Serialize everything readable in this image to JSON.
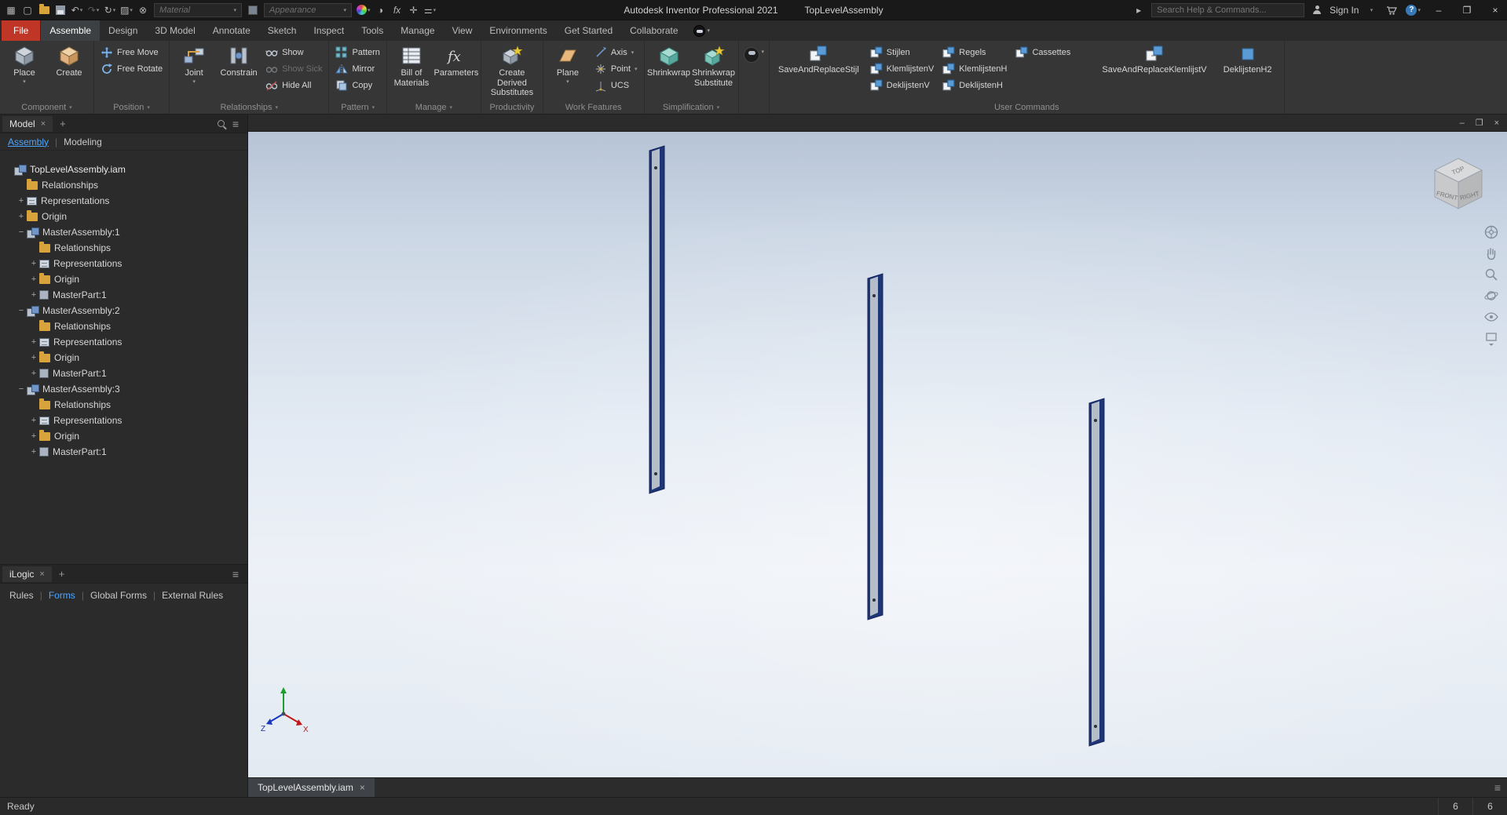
{
  "colors": {
    "file_tab_red": "#bf3526",
    "accent_blue": "#4da6ff",
    "titlebar_bg": "#191919",
    "ribbon_bg": "#363636",
    "panel_bg": "#2b2b2b",
    "viewport_top": "#b7c4d6",
    "viewport_light": "#edf1f7",
    "post_edge": "#1e3576",
    "post_face": "#b4bdc8"
  },
  "titlebar": {
    "app_title": "Autodesk Inventor Professional 2021",
    "doc_title": "TopLevelAssembly",
    "material_label": "Material",
    "appearance_label": "Appearance",
    "search_placeholder": "Search Help & Commands...",
    "signin_label": "Sign In"
  },
  "tabs": {
    "items": [
      "File",
      "Assemble",
      "Design",
      "3D Model",
      "Annotate",
      "Sketch",
      "Inspect",
      "Tools",
      "Manage",
      "View",
      "Environments",
      "Get Started",
      "Collaborate"
    ],
    "active": "Assemble"
  },
  "ribbon": {
    "component": {
      "label": "Component",
      "place": "Place",
      "create": "Create"
    },
    "position": {
      "label": "Position",
      "free_move": "Free Move",
      "free_rotate": "Free Rotate"
    },
    "relationships": {
      "label": "Relationships",
      "joint": "Joint",
      "constrain": "Constrain",
      "show": "Show",
      "show_sick": "Show Sick",
      "hide_all": "Hide All"
    },
    "pattern": {
      "label": "Pattern",
      "pattern": "Pattern",
      "mirror": "Mirror",
      "copy": "Copy"
    },
    "manage": {
      "label": "Manage",
      "bom": "Bill of Materials",
      "parameters": "Parameters"
    },
    "productivity": {
      "label": "Productivity",
      "create_derived": "Create Derived Substitutes"
    },
    "work_features": {
      "label": "Work Features",
      "plane": "Plane",
      "axis": "Axis",
      "point": "Point",
      "ucs": "UCS"
    },
    "simplification": {
      "label": "Simplification",
      "shrinkwrap": "Shrinkwrap",
      "shrinkwrap_substitute": "Shrinkwrap Substitute"
    },
    "user_commands": {
      "label": "User Commands",
      "large": [
        "SaveAndReplaceStijl",
        "SaveAndReplaceKlemlijstV",
        "DeklijstenH2"
      ],
      "col1": [
        "Stijlen",
        "KlemlijstenV",
        "DeklijstenV"
      ],
      "col2": [
        "Regels",
        "KlemlijstenH",
        "DeklijstenH"
      ],
      "col3": [
        "Cassettes"
      ]
    }
  },
  "browser": {
    "tab_label": "Model",
    "subtabs": [
      "Assembly",
      "Modeling"
    ],
    "tree": [
      {
        "expander": "",
        "label": "TopLevelAssembly.iam",
        "indent": 0,
        "icon": "assembly"
      },
      {
        "expander": "",
        "label": "Relationships",
        "indent": 1,
        "icon": "folder"
      },
      {
        "expander": "+",
        "label": "Representations",
        "indent": 1,
        "icon": "representations"
      },
      {
        "expander": "+",
        "label": "Origin",
        "indent": 1,
        "icon": "folder"
      },
      {
        "expander": "−",
        "label": "MasterAssembly:1",
        "indent": 1,
        "icon": "assembly"
      },
      {
        "expander": "",
        "label": "Relationships",
        "indent": 2,
        "icon": "folder"
      },
      {
        "expander": "+",
        "label": "Representations",
        "indent": 2,
        "icon": "representations"
      },
      {
        "expander": "+",
        "label": "Origin",
        "indent": 2,
        "icon": "folder"
      },
      {
        "expander": "+",
        "label": "MasterPart:1",
        "indent": 2,
        "icon": "part"
      },
      {
        "expander": "−",
        "label": "MasterAssembly:2",
        "indent": 1,
        "icon": "assembly"
      },
      {
        "expander": "",
        "label": "Relationships",
        "indent": 2,
        "icon": "folder"
      },
      {
        "expander": "+",
        "label": "Representations",
        "indent": 2,
        "icon": "representations"
      },
      {
        "expander": "+",
        "label": "Origin",
        "indent": 2,
        "icon": "folder"
      },
      {
        "expander": "+",
        "label": "MasterPart:1",
        "indent": 2,
        "icon": "part"
      },
      {
        "expander": "−",
        "label": "MasterAssembly:3",
        "indent": 1,
        "icon": "assembly"
      },
      {
        "expander": "",
        "label": "Relationships",
        "indent": 2,
        "icon": "folder"
      },
      {
        "expander": "+",
        "label": "Representations",
        "indent": 2,
        "icon": "representations"
      },
      {
        "expander": "+",
        "label": "Origin",
        "indent": 2,
        "icon": "folder"
      },
      {
        "expander": "+",
        "label": "MasterPart:1",
        "indent": 2,
        "icon": "part"
      }
    ]
  },
  "ilogic": {
    "tab_label": "iLogic",
    "links": [
      "Rules",
      "Forms",
      "Global Forms",
      "External Rules"
    ],
    "active_link": "Forms"
  },
  "viewport": {
    "doc_tab": "TopLevelAssembly.iam",
    "viewcube": {
      "top": "TOP",
      "front": "FRONT",
      "right": "RIGHT"
    },
    "triad": {
      "x": "X",
      "z": "Z"
    }
  },
  "statusbar": {
    "message": "Ready",
    "count1": "6",
    "count2": "6"
  }
}
